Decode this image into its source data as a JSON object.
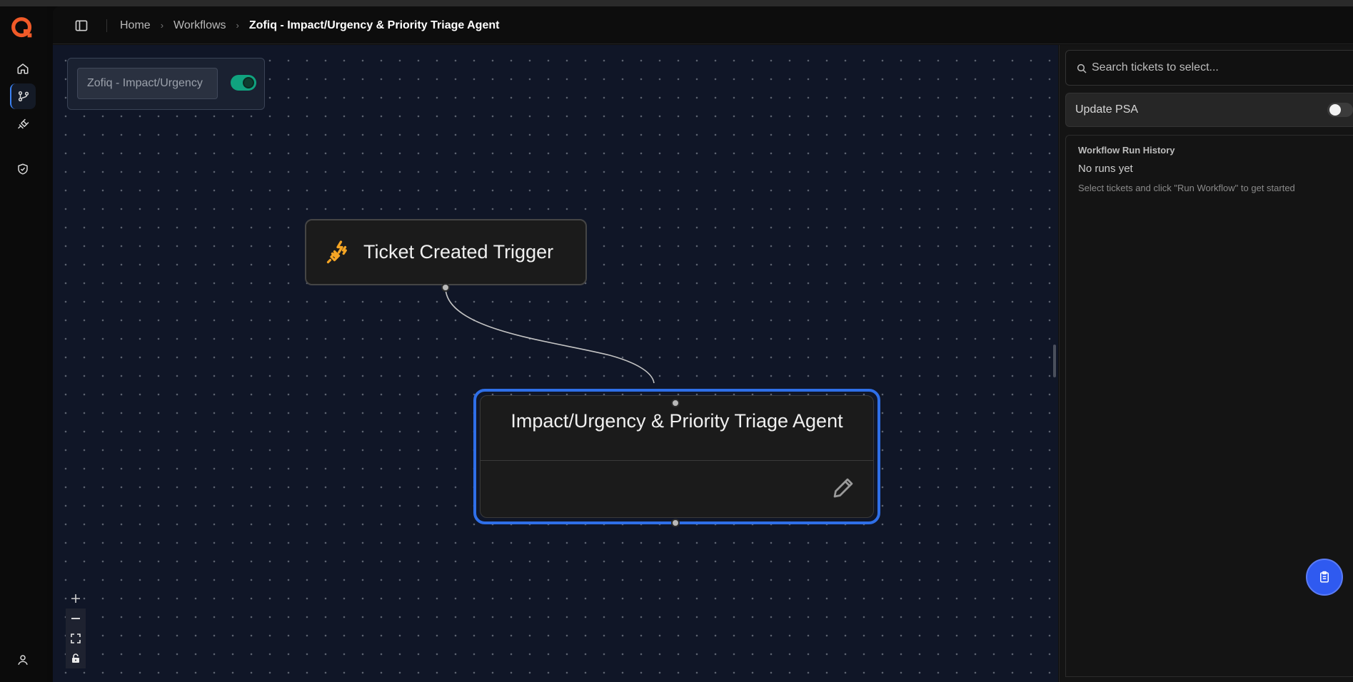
{
  "rail": {
    "items": [
      {
        "name": "home",
        "icon": "home-icon"
      },
      {
        "name": "workflows",
        "icon": "git-branch-icon",
        "active": true
      },
      {
        "name": "integrations",
        "icon": "plug-icon"
      },
      {
        "name": "security",
        "icon": "shield-check-icon"
      }
    ],
    "bottom_icon": "user-icon"
  },
  "header": {
    "breadcrumb": [
      "Home",
      "Workflows",
      "Zofiq - Impact/Urgency & Priority Triage Agent"
    ]
  },
  "canvas": {
    "workflow_name": "Zofiq - Impact/Urgency",
    "workflow_enabled": true,
    "nodes": {
      "trigger": {
        "label": "Ticket Created Trigger",
        "icon": "plug-zap-icon"
      },
      "agent": {
        "label": "Impact/Urgency & Priority Triage Agent",
        "icon": "pencil-icon"
      }
    },
    "controls": [
      "zoom-in",
      "zoom-out",
      "fit-view",
      "lock"
    ]
  },
  "panel": {
    "search_placeholder": "Search tickets to select...",
    "update_psa_label": "Update PSA",
    "update_psa_enabled": false,
    "history_title": "Workflow Run History",
    "history_empty": "No runs yet",
    "history_hint": "Select tickets and click \"Run Workflow\" to get started"
  },
  "colors": {
    "accent": "#2f6fe8",
    "brand": "#f05a28",
    "toggle_on": "#10a37f",
    "canvas_bg": "#101627"
  }
}
